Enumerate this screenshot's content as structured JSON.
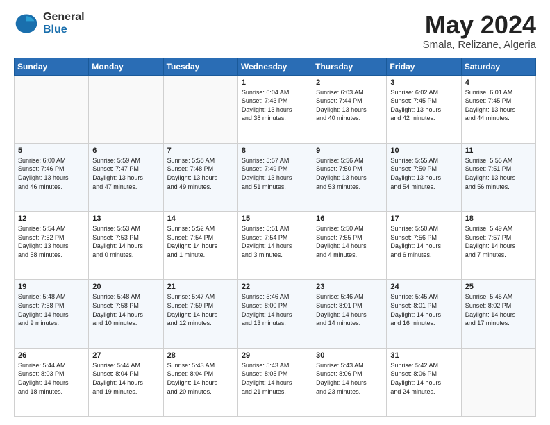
{
  "logo": {
    "general": "General",
    "blue": "Blue"
  },
  "title": "May 2024",
  "location": "Smala, Relizane, Algeria",
  "headers": [
    "Sunday",
    "Monday",
    "Tuesday",
    "Wednesday",
    "Thursday",
    "Friday",
    "Saturday"
  ],
  "weeks": [
    [
      {
        "day": "",
        "content": ""
      },
      {
        "day": "",
        "content": ""
      },
      {
        "day": "",
        "content": ""
      },
      {
        "day": "1",
        "content": "Sunrise: 6:04 AM\nSunset: 7:43 PM\nDaylight: 13 hours\nand 38 minutes."
      },
      {
        "day": "2",
        "content": "Sunrise: 6:03 AM\nSunset: 7:44 PM\nDaylight: 13 hours\nand 40 minutes."
      },
      {
        "day": "3",
        "content": "Sunrise: 6:02 AM\nSunset: 7:45 PM\nDaylight: 13 hours\nand 42 minutes."
      },
      {
        "day": "4",
        "content": "Sunrise: 6:01 AM\nSunset: 7:45 PM\nDaylight: 13 hours\nand 44 minutes."
      }
    ],
    [
      {
        "day": "5",
        "content": "Sunrise: 6:00 AM\nSunset: 7:46 PM\nDaylight: 13 hours\nand 46 minutes."
      },
      {
        "day": "6",
        "content": "Sunrise: 5:59 AM\nSunset: 7:47 PM\nDaylight: 13 hours\nand 47 minutes."
      },
      {
        "day": "7",
        "content": "Sunrise: 5:58 AM\nSunset: 7:48 PM\nDaylight: 13 hours\nand 49 minutes."
      },
      {
        "day": "8",
        "content": "Sunrise: 5:57 AM\nSunset: 7:49 PM\nDaylight: 13 hours\nand 51 minutes."
      },
      {
        "day": "9",
        "content": "Sunrise: 5:56 AM\nSunset: 7:50 PM\nDaylight: 13 hours\nand 53 minutes."
      },
      {
        "day": "10",
        "content": "Sunrise: 5:55 AM\nSunset: 7:50 PM\nDaylight: 13 hours\nand 54 minutes."
      },
      {
        "day": "11",
        "content": "Sunrise: 5:55 AM\nSunset: 7:51 PM\nDaylight: 13 hours\nand 56 minutes."
      }
    ],
    [
      {
        "day": "12",
        "content": "Sunrise: 5:54 AM\nSunset: 7:52 PM\nDaylight: 13 hours\nand 58 minutes."
      },
      {
        "day": "13",
        "content": "Sunrise: 5:53 AM\nSunset: 7:53 PM\nDaylight: 14 hours\nand 0 minutes."
      },
      {
        "day": "14",
        "content": "Sunrise: 5:52 AM\nSunset: 7:54 PM\nDaylight: 14 hours\nand 1 minute."
      },
      {
        "day": "15",
        "content": "Sunrise: 5:51 AM\nSunset: 7:54 PM\nDaylight: 14 hours\nand 3 minutes."
      },
      {
        "day": "16",
        "content": "Sunrise: 5:50 AM\nSunset: 7:55 PM\nDaylight: 14 hours\nand 4 minutes."
      },
      {
        "day": "17",
        "content": "Sunrise: 5:50 AM\nSunset: 7:56 PM\nDaylight: 14 hours\nand 6 minutes."
      },
      {
        "day": "18",
        "content": "Sunrise: 5:49 AM\nSunset: 7:57 PM\nDaylight: 14 hours\nand 7 minutes."
      }
    ],
    [
      {
        "day": "19",
        "content": "Sunrise: 5:48 AM\nSunset: 7:58 PM\nDaylight: 14 hours\nand 9 minutes."
      },
      {
        "day": "20",
        "content": "Sunrise: 5:48 AM\nSunset: 7:58 PM\nDaylight: 14 hours\nand 10 minutes."
      },
      {
        "day": "21",
        "content": "Sunrise: 5:47 AM\nSunset: 7:59 PM\nDaylight: 14 hours\nand 12 minutes."
      },
      {
        "day": "22",
        "content": "Sunrise: 5:46 AM\nSunset: 8:00 PM\nDaylight: 14 hours\nand 13 minutes."
      },
      {
        "day": "23",
        "content": "Sunrise: 5:46 AM\nSunset: 8:01 PM\nDaylight: 14 hours\nand 14 minutes."
      },
      {
        "day": "24",
        "content": "Sunrise: 5:45 AM\nSunset: 8:01 PM\nDaylight: 14 hours\nand 16 minutes."
      },
      {
        "day": "25",
        "content": "Sunrise: 5:45 AM\nSunset: 8:02 PM\nDaylight: 14 hours\nand 17 minutes."
      }
    ],
    [
      {
        "day": "26",
        "content": "Sunrise: 5:44 AM\nSunset: 8:03 PM\nDaylight: 14 hours\nand 18 minutes."
      },
      {
        "day": "27",
        "content": "Sunrise: 5:44 AM\nSunset: 8:04 PM\nDaylight: 14 hours\nand 19 minutes."
      },
      {
        "day": "28",
        "content": "Sunrise: 5:43 AM\nSunset: 8:04 PM\nDaylight: 14 hours\nand 20 minutes."
      },
      {
        "day": "29",
        "content": "Sunrise: 5:43 AM\nSunset: 8:05 PM\nDaylight: 14 hours\nand 21 minutes."
      },
      {
        "day": "30",
        "content": "Sunrise: 5:43 AM\nSunset: 8:06 PM\nDaylight: 14 hours\nand 23 minutes."
      },
      {
        "day": "31",
        "content": "Sunrise: 5:42 AM\nSunset: 8:06 PM\nDaylight: 14 hours\nand 24 minutes."
      },
      {
        "day": "",
        "content": ""
      }
    ]
  ]
}
